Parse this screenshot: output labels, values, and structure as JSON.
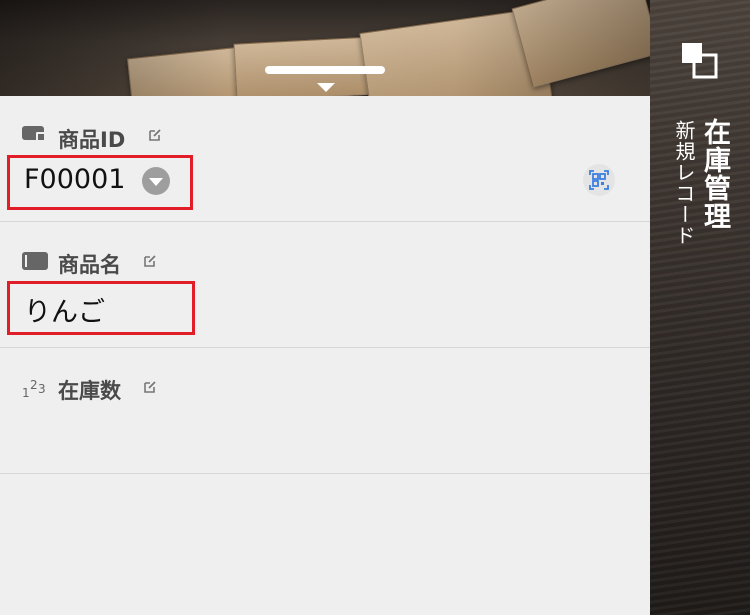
{
  "app": {
    "title": "在庫管理",
    "subtitle": "新規レコード"
  },
  "fields": [
    {
      "label": "商品ID",
      "type_icon": "id-card-icon",
      "value": "F00001",
      "has_dropdown": true,
      "has_qr_scanner": true
    },
    {
      "label": "商品名",
      "type_icon": "text-field-icon",
      "value": "りんご"
    },
    {
      "label": "在庫数",
      "type_icon": "number-123-icon",
      "value": ""
    }
  ],
  "colors": {
    "highlight": "#e11d27",
    "background": "#efefef",
    "label": "#4a4a4a",
    "qr_accent": "#3b7fe0"
  }
}
